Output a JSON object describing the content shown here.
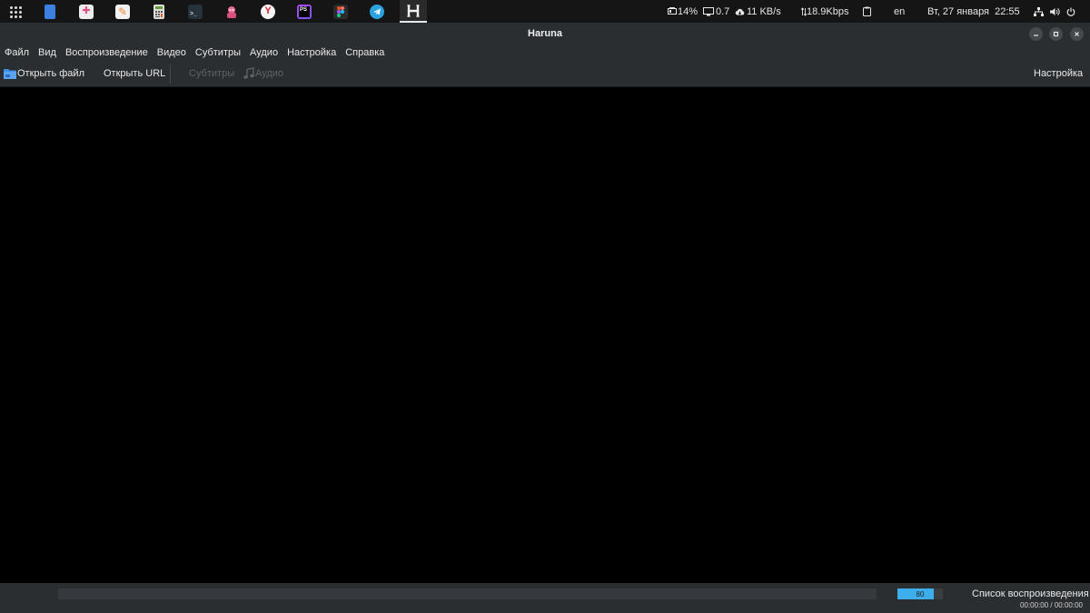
{
  "taskbar": {
    "apps": [
      {
        "name": "document-viewer",
        "color": "#3d7fe0",
        "glyph": "▯"
      },
      {
        "name": "software-store",
        "color": "#e9e9e9",
        "glyph": "✚"
      },
      {
        "name": "text-editor",
        "color": "#f0f0f0",
        "glyph": "✎"
      },
      {
        "name": "calculator",
        "color": "#8bc34a",
        "glyph": "▦"
      },
      {
        "name": "terminal",
        "color": "#2e3b45",
        "glyph": ">_"
      },
      {
        "name": "pink-app",
        "color": "#e0608a",
        "glyph": "◉"
      },
      {
        "name": "yandex-browser",
        "color": "#f5f5f5",
        "glyph": "Y"
      },
      {
        "name": "phpstorm",
        "color": "#9c3ee0",
        "glyph": "PS"
      },
      {
        "name": "figma",
        "color": "#2b2b2b",
        "glyph": "F"
      },
      {
        "name": "telegram",
        "color": "#2aa3e0",
        "glyph": "➤"
      },
      {
        "name": "haruna",
        "color": "#3a3a3a",
        "glyph": "H"
      }
    ]
  },
  "tray": {
    "battery": "14%",
    "load": "0.7",
    "network_down": "11 KB/s",
    "bitrate": "18.9Kbps",
    "keyboard_layout": "en",
    "datetime": "Вт, 27 января  22:55"
  },
  "window": {
    "title": "Haruna"
  },
  "menu": {
    "items": [
      "Файл",
      "Вид",
      "Воспроизведение",
      "Видео",
      "Субтитры",
      "Аудио",
      "Настройка",
      "Справка"
    ]
  },
  "toolbar": {
    "open_file": "Открыть файл",
    "open_url": "Открыть URL",
    "subtitles": "Субтитры",
    "audio": "Аудио",
    "settings": "Настройка"
  },
  "footer": {
    "volume": "80",
    "volume_level": 0.8,
    "playlist": "Список воспроизведения",
    "time": "00:00:00 / 00:00:00"
  },
  "colors": {
    "accent": "#3daee9",
    "window_bg": "#2b2e31",
    "panel_bg": "#151515",
    "video_bg": "#000000"
  }
}
